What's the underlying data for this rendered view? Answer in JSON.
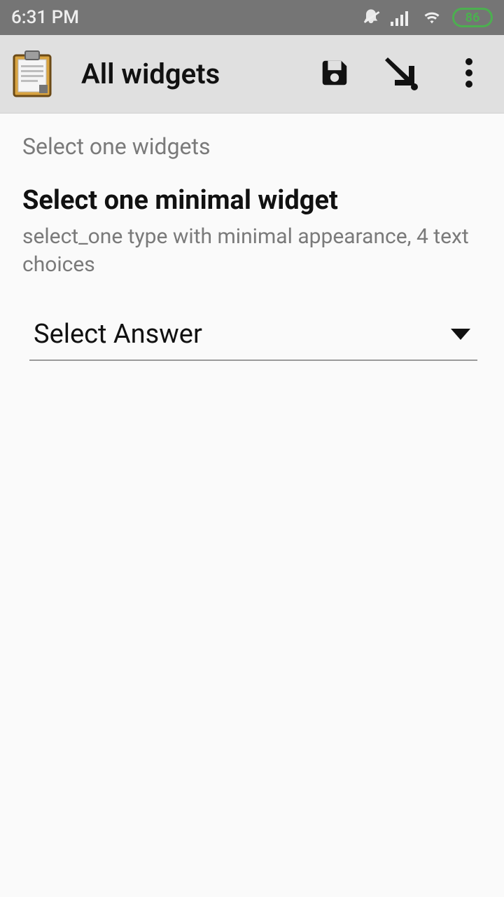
{
  "status_bar": {
    "time": "6:31 PM",
    "battery": "86"
  },
  "app_bar": {
    "title": "All widgets"
  },
  "content": {
    "section_label": "Select one widgets",
    "question_title": "Select one minimal widget",
    "question_hint": "select_one type with minimal appearance, 4 text choices",
    "select_placeholder": "Select Answer"
  }
}
